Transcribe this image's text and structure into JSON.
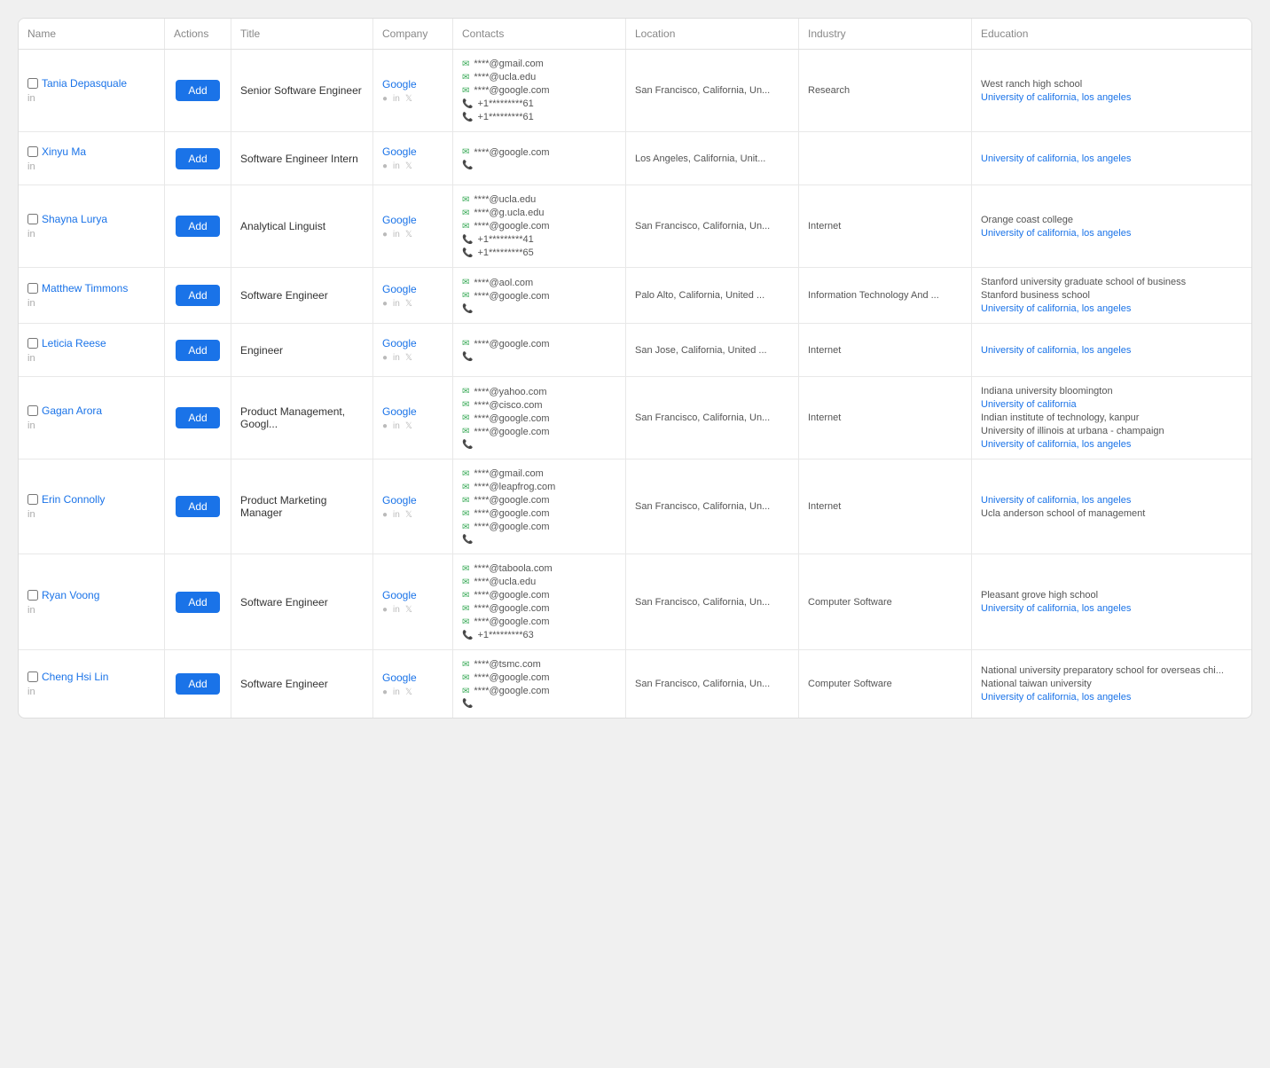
{
  "colors": {
    "add_button_bg": "#1a73e8",
    "link_color": "#1a73e8",
    "email_icon": "#34a853",
    "phone_icon": "#34a853"
  },
  "header": {
    "col_name": "Name",
    "col_actions": "Actions",
    "col_title": "Title",
    "col_company": "Company",
    "col_contacts": "Contacts",
    "col_location": "Location",
    "col_industry": "Industry",
    "col_education": "Education"
  },
  "add_label": "Add",
  "rows": [
    {
      "id": "tania",
      "name": "Tania Depasquale",
      "title": "Senior Software Engineer",
      "company": "Google",
      "location": "San Francisco, California, Un...",
      "industry": "Research",
      "emails": [
        "****@gmail.com",
        "****@ucla.edu",
        "****@google.com"
      ],
      "phones": [
        "+1*********61",
        "+1*********61"
      ],
      "phone_placeholder": false,
      "education": [
        "West ranch high school",
        "University of california, los angeles"
      ],
      "edu_types": [
        "text",
        "link"
      ]
    },
    {
      "id": "xinyu",
      "name": "Xinyu Ma",
      "title": "Software Engineer Intern",
      "company": "Google",
      "location": "Los Angeles, California, Unit...",
      "industry": "",
      "emails": [
        "****@google.com"
      ],
      "phones": [],
      "phone_placeholder": true,
      "education": [
        "University of california, los angeles"
      ],
      "edu_types": [
        "link"
      ]
    },
    {
      "id": "shayna",
      "name": "Shayna Lurya",
      "title": "Analytical Linguist",
      "company": "Google",
      "location": "San Francisco, California, Un...",
      "industry": "Internet",
      "emails": [
        "****@ucla.edu",
        "****@g.ucla.edu",
        "****@google.com"
      ],
      "phones": [
        "+1*********41",
        "+1*********65"
      ],
      "phone_placeholder": false,
      "education": [
        "Orange coast college",
        "University of california, los angeles"
      ],
      "edu_types": [
        "text",
        "link"
      ]
    },
    {
      "id": "matthew",
      "name": "Matthew Timmons",
      "title": "Software Engineer",
      "company": "Google",
      "location": "Palo Alto, California, United ...",
      "industry": "Information Technology And ...",
      "emails": [
        "****@aol.com",
        "****@google.com"
      ],
      "phones": [],
      "phone_placeholder": true,
      "education": [
        "Stanford university graduate school of business",
        "Stanford business school",
        "University of california, los angeles"
      ],
      "edu_types": [
        "text",
        "text",
        "link"
      ]
    },
    {
      "id": "leticia",
      "name": "Leticia Reese",
      "title": "Engineer",
      "company": "Google",
      "location": "San Jose, California, United ...",
      "industry": "Internet",
      "emails": [
        "****@google.com"
      ],
      "phones": [],
      "phone_placeholder": true,
      "education": [
        "University of california, los angeles"
      ],
      "edu_types": [
        "link"
      ]
    },
    {
      "id": "gagan",
      "name": "Gagan Arora",
      "title": "Product Management, Googl...",
      "company": "Google",
      "location": "San Francisco, California, Un...",
      "industry": "Internet",
      "emails": [
        "****@yahoo.com",
        "****@cisco.com",
        "****@google.com",
        "****@google.com"
      ],
      "phones": [],
      "phone_placeholder": true,
      "education": [
        "Indiana university bloomington",
        "University of california",
        "Indian institute of technology, kanpur",
        "University of illinois at urbana - champaign",
        "University of california, los angeles"
      ],
      "edu_types": [
        "text",
        "link",
        "text",
        "text",
        "link"
      ]
    },
    {
      "id": "erin",
      "name": "Erin Connolly",
      "title": "Product Marketing Manager",
      "company": "Google",
      "location": "San Francisco, California, Un...",
      "industry": "Internet",
      "emails": [
        "****@gmail.com",
        "****@leapfrog.com",
        "****@google.com",
        "****@google.com",
        "****@google.com"
      ],
      "phones": [],
      "phone_placeholder": true,
      "education": [
        "University of california, los angeles",
        "Ucla anderson school of management"
      ],
      "edu_types": [
        "link",
        "text"
      ]
    },
    {
      "id": "ryan",
      "name": "Ryan Voong",
      "title": "Software Engineer",
      "company": "Google",
      "location": "San Francisco, California, Un...",
      "industry": "Computer Software",
      "emails": [
        "****@taboola.com",
        "****@ucla.edu",
        "****@google.com",
        "****@google.com",
        "****@google.com"
      ],
      "phones": [
        "+1*********63"
      ],
      "phone_placeholder": false,
      "education": [
        "Pleasant grove high school",
        "University of california, los angeles"
      ],
      "edu_types": [
        "text",
        "link"
      ]
    },
    {
      "id": "cheng",
      "name": "Cheng Hsi Lin",
      "title": "Software Engineer",
      "company": "Google",
      "location": "San Francisco, California, Un...",
      "industry": "Computer Software",
      "emails": [
        "****@tsmc.com",
        "****@google.com",
        "****@google.com"
      ],
      "phones": [],
      "phone_placeholder": true,
      "education": [
        "National university preparatory school for overseas chi...",
        "National taiwan university",
        "University of california, los angeles"
      ],
      "edu_types": [
        "text",
        "text",
        "link"
      ]
    }
  ]
}
